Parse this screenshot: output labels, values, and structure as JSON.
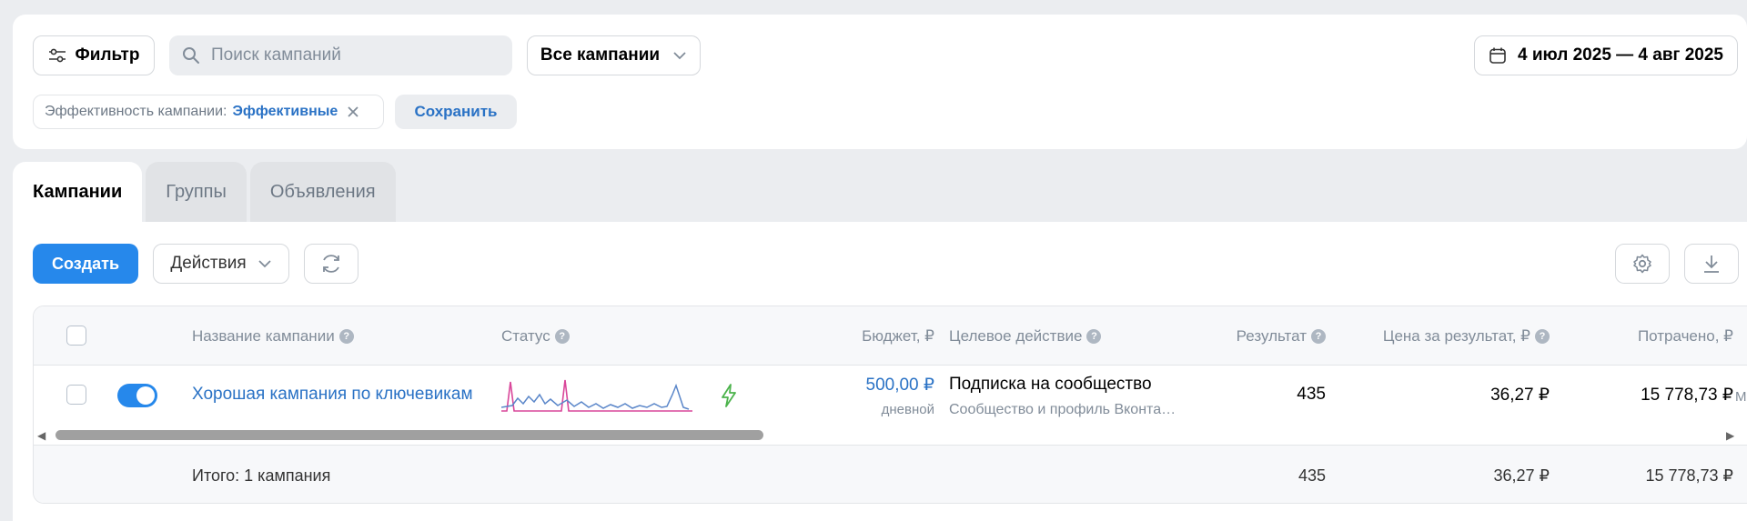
{
  "filters": {
    "filter_label": "Фильтр",
    "search_placeholder": "Поиск кампаний",
    "all_campaigns": "Все кампании",
    "date_range": "4 июл 2025 — 4 авг 2025",
    "chip_key": "Эффективность кампании:",
    "chip_value": "Эффективные",
    "save_label": "Сохранить"
  },
  "tabs": [
    {
      "label": "Кампании",
      "active": true
    },
    {
      "label": "Группы",
      "active": false
    },
    {
      "label": "Объявления",
      "active": false
    }
  ],
  "toolbar": {
    "create_label": "Создать",
    "actions_label": "Действия"
  },
  "table": {
    "columns": {
      "name": "Название кампании",
      "status": "Статус",
      "budget": "Бюджет, ₽",
      "target": "Целевое действие",
      "result": "Результат",
      "cost": "Цена за результат, ₽",
      "spent": "Потрачено, ₽"
    },
    "row": {
      "name": "Хорошая кампания по ключевикам",
      "budget": "500,00 ₽",
      "budget_period": "дневной",
      "target": "Подписка на сообщество",
      "target_sub": "Сообщество и профиль Вконта…",
      "result": "435",
      "cost": "36,27 ₽",
      "spent": "15 778,73 ₽",
      "overflow": "Ми"
    },
    "total": {
      "label": "Итого: 1 кампания",
      "result": "435",
      "cost": "36,27 ₽",
      "spent": "15 778,73 ₽"
    }
  },
  "colors": {
    "accent": "#2688eb",
    "link": "#2a72c5",
    "spark_pink": "#d9479a",
    "spark_blue": "#5a86c9",
    "status_green": "#4bb34b"
  }
}
